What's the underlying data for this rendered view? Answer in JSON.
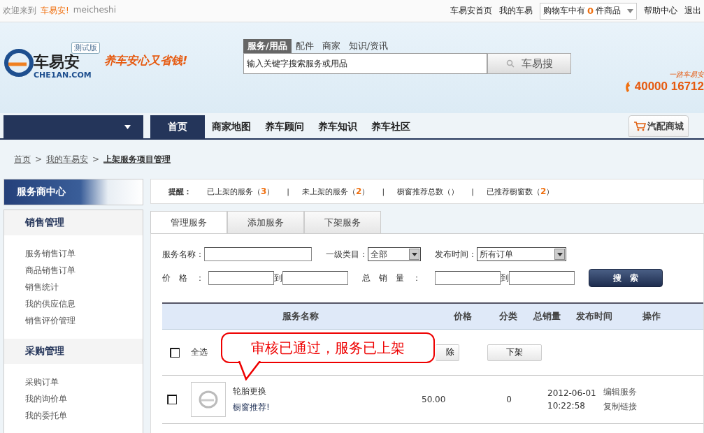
{
  "top_bar": {
    "welcome": "欢迎来到",
    "site": "车易安!",
    "user": "meicheshi",
    "links": [
      "车易安首页",
      "我的车易"
    ],
    "cart": {
      "prefix": "购物车中有",
      "count": "0",
      "suffix": "件商品"
    },
    "links_right": [
      "帮助中心",
      "退出"
    ]
  },
  "header": {
    "logo": {
      "badge": "测试版",
      "name": "车易安",
      "domain": "CHE1AN.COM"
    },
    "slogan": "养车安心又省钱!",
    "search_tabs": [
      {
        "label": "服务/用品",
        "selected": true
      },
      {
        "label": "配件",
        "selected": false
      },
      {
        "label": "商家",
        "selected": false
      },
      {
        "label": "知识/资讯",
        "selected": false
      }
    ],
    "search": {
      "placeholder": "输入关键字搜索服务或用品",
      "button": "车易搜"
    },
    "hotline": {
      "caption": "一路车易安",
      "number": "40000 16712"
    }
  },
  "nav": {
    "items": [
      {
        "label": "首页",
        "selected": true
      },
      {
        "label": "商家地图",
        "selected": false
      },
      {
        "label": "养车顾问",
        "selected": false
      },
      {
        "label": "养车知识",
        "selected": false
      },
      {
        "label": "养车社区",
        "selected": false
      }
    ],
    "mall": "汽配商城"
  },
  "breadcrumb": {
    "separator": ">",
    "items": [
      "首页",
      "我的车易安",
      "上架服务项目管理"
    ]
  },
  "sidebar": {
    "title": "服务商中心",
    "sections": [
      {
        "title": "销售管理",
        "items": [
          "服务销售订单",
          "商品销售订单",
          "销售统计",
          "我的供应信息",
          "销售评价管理"
        ]
      },
      {
        "title": "采购管理",
        "items": [
          "采购订单",
          "我的询价单",
          "我的委托单"
        ]
      }
    ]
  },
  "reminder": {
    "label": "提醒：",
    "separator": "|",
    "items": [
      {
        "label": "已上架的服务（",
        "count": "3",
        "end": "）"
      },
      {
        "label": "未上架的服务（",
        "count": "2",
        "end": "）"
      },
      {
        "label": "橱窗推荐总数（",
        "end": "）"
      },
      {
        "label": "已推荐橱窗数（",
        "count": "2",
        "end": "）"
      }
    ]
  },
  "tabs": [
    {
      "label": "管理服务",
      "selected": true
    },
    {
      "label": "添加服务",
      "selected": false
    },
    {
      "label": "下架服务",
      "selected": false
    }
  ],
  "filters": {
    "name_label": "服务名称：",
    "category_label": "一级类目：",
    "category_value": "全部",
    "time_label": "发布时间：",
    "time_value": "所有订单",
    "price_label": "价　格　：",
    "sales_label": "总　销　量　：",
    "price_range_word": "到",
    "sales_range_word": "到",
    "button": "搜　索"
  },
  "table": {
    "columns": [
      "服务名称",
      "价格",
      "分类",
      "总销量",
      "发布时间",
      "操作"
    ],
    "bulk": {
      "checked": false,
      "select_all": "全选",
      "buttons": [
        "除",
        "下架"
      ]
    },
    "rows": [
      {
        "checked": false,
        "name": "轮胎更换",
        "tag": "橱窗推荐!",
        "price": "50.00",
        "sales": "0",
        "date": "2012-06-01",
        "time": "10:22:58",
        "actions": [
          "编辑服务",
          "复制链接"
        ]
      }
    ]
  },
  "callout": "审核已通过，服务已上架"
}
